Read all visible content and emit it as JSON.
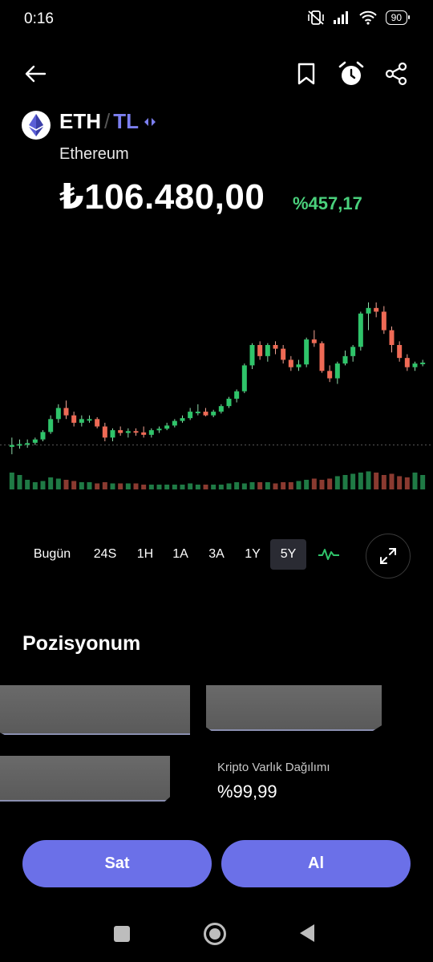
{
  "status_bar": {
    "time": "0:16",
    "battery": "90"
  },
  "asset": {
    "base": "ETH",
    "separator": "/",
    "quote": "TL",
    "name": "Ethereum",
    "price": "₺106.480,00",
    "change": "%457,17",
    "colors": {
      "quote": "#7c7ff0",
      "change_positive": "#4ad07c"
    }
  },
  "ranges": {
    "items": [
      "Bugün",
      "24S",
      "1H",
      "1A",
      "3A",
      "1Y",
      "5Y"
    ],
    "active": "5Y"
  },
  "position": {
    "title": "Pozisyonum",
    "distribution_label": "Kripto Varlık Dağılımı",
    "distribution_value": "%99,99"
  },
  "actions": {
    "sell": "Sat",
    "buy": "Al"
  },
  "chart_data": {
    "type": "candlestick",
    "colors": {
      "up": "#2fc46a",
      "down": "#ef6a55"
    },
    "candles": [
      {
        "o": 550,
        "h": 600,
        "l": 510,
        "c": 560
      },
      {
        "o": 560,
        "h": 590,
        "l": 540,
        "c": 565
      },
      {
        "o": 565,
        "h": 590,
        "l": 545,
        "c": 570
      },
      {
        "o": 572,
        "h": 600,
        "l": 560,
        "c": 590
      },
      {
        "o": 590,
        "h": 640,
        "l": 580,
        "c": 630
      },
      {
        "o": 630,
        "h": 720,
        "l": 620,
        "c": 700
      },
      {
        "o": 700,
        "h": 780,
        "l": 680,
        "c": 760
      },
      {
        "o": 760,
        "h": 800,
        "l": 700,
        "c": 720
      },
      {
        "o": 720,
        "h": 740,
        "l": 660,
        "c": 680
      },
      {
        "o": 680,
        "h": 720,
        "l": 660,
        "c": 700
      },
      {
        "o": 700,
        "h": 720,
        "l": 680,
        "c": 700
      },
      {
        "o": 700,
        "h": 710,
        "l": 650,
        "c": 660
      },
      {
        "o": 660,
        "h": 680,
        "l": 580,
        "c": 600
      },
      {
        "o": 600,
        "h": 650,
        "l": 580,
        "c": 640
      },
      {
        "o": 640,
        "h": 660,
        "l": 610,
        "c": 625
      },
      {
        "o": 625,
        "h": 650,
        "l": 600,
        "c": 635
      },
      {
        "o": 635,
        "h": 650,
        "l": 610,
        "c": 628
      },
      {
        "o": 628,
        "h": 660,
        "l": 600,
        "c": 615
      },
      {
        "o": 615,
        "h": 650,
        "l": 600,
        "c": 640
      },
      {
        "o": 640,
        "h": 660,
        "l": 625,
        "c": 648
      },
      {
        "o": 648,
        "h": 680,
        "l": 640,
        "c": 665
      },
      {
        "o": 665,
        "h": 700,
        "l": 655,
        "c": 690
      },
      {
        "o": 690,
        "h": 720,
        "l": 680,
        "c": 705
      },
      {
        "o": 705,
        "h": 760,
        "l": 695,
        "c": 740
      },
      {
        "o": 740,
        "h": 780,
        "l": 720,
        "c": 740
      },
      {
        "o": 740,
        "h": 760,
        "l": 715,
        "c": 720
      },
      {
        "o": 720,
        "h": 750,
        "l": 710,
        "c": 740
      },
      {
        "o": 740,
        "h": 780,
        "l": 730,
        "c": 770
      },
      {
        "o": 770,
        "h": 820,
        "l": 760,
        "c": 810
      },
      {
        "o": 810,
        "h": 860,
        "l": 790,
        "c": 850
      },
      {
        "o": 850,
        "h": 1000,
        "l": 840,
        "c": 990
      },
      {
        "o": 990,
        "h": 1110,
        "l": 970,
        "c": 1100
      },
      {
        "o": 1100,
        "h": 1120,
        "l": 1020,
        "c": 1040
      },
      {
        "o": 1040,
        "h": 1110,
        "l": 1010,
        "c": 1100
      },
      {
        "o": 1100,
        "h": 1120,
        "l": 1050,
        "c": 1080
      },
      {
        "o": 1080,
        "h": 1100,
        "l": 1000,
        "c": 1020
      },
      {
        "o": 1020,
        "h": 1040,
        "l": 960,
        "c": 980
      },
      {
        "o": 980,
        "h": 1020,
        "l": 960,
        "c": 995
      },
      {
        "o": 995,
        "h": 1140,
        "l": 980,
        "c": 1130
      },
      {
        "o": 1130,
        "h": 1180,
        "l": 1090,
        "c": 1110
      },
      {
        "o": 1110,
        "h": 1120,
        "l": 950,
        "c": 960
      },
      {
        "o": 960,
        "h": 990,
        "l": 900,
        "c": 920
      },
      {
        "o": 920,
        "h": 1010,
        "l": 890,
        "c": 1000
      },
      {
        "o": 1000,
        "h": 1070,
        "l": 990,
        "c": 1040
      },
      {
        "o": 1040,
        "h": 1100,
        "l": 1010,
        "c": 1090
      },
      {
        "o": 1090,
        "h": 1280,
        "l": 1070,
        "c": 1270
      },
      {
        "o": 1270,
        "h": 1330,
        "l": 1180,
        "c": 1300
      },
      {
        "o": 1300,
        "h": 1330,
        "l": 1250,
        "c": 1280
      },
      {
        "o": 1280,
        "h": 1310,
        "l": 1160,
        "c": 1180
      },
      {
        "o": 1180,
        "h": 1200,
        "l": 1060,
        "c": 1100
      },
      {
        "o": 1100,
        "h": 1120,
        "l": 1010,
        "c": 1030
      },
      {
        "o": 1030,
        "h": 1050,
        "l": 960,
        "c": 980
      },
      {
        "o": 980,
        "h": 1010,
        "l": 960,
        "c": 1000
      },
      {
        "o": 1000,
        "h": 1020,
        "l": 985,
        "c": 1005
      }
    ],
    "volumes": [
      14,
      12,
      8,
      6,
      7,
      10,
      9,
      8,
      7,
      6,
      6,
      5,
      6,
      5,
      5,
      5,
      5,
      4,
      4,
      4,
      4,
      4,
      4,
      5,
      4,
      4,
      4,
      4,
      5,
      6,
      5,
      6,
      6,
      6,
      5,
      6,
      6,
      7,
      8,
      9,
      8,
      9,
      11,
      12,
      13,
      14,
      15,
      14,
      12,
      13,
      11,
      10,
      14,
      12
    ],
    "reference_line": 560,
    "y_range": [
      450,
      1360
    ],
    "volume_range": [
      0,
      16
    ]
  }
}
